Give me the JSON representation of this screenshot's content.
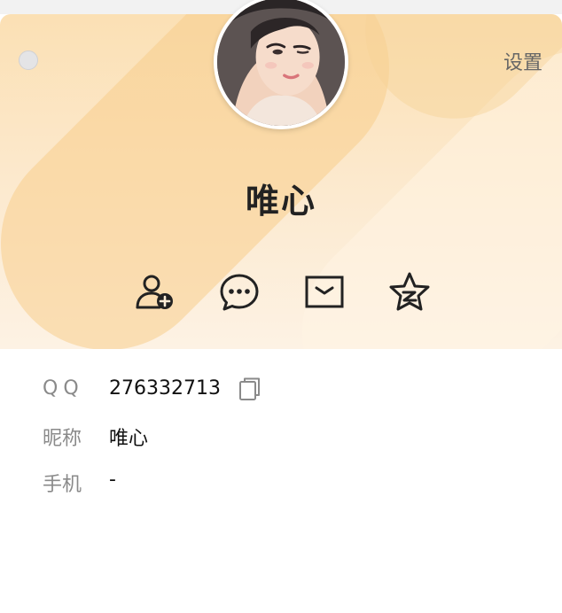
{
  "header": {
    "settings_label": "设置",
    "display_name": "唯心"
  },
  "actions": [
    {
      "name": "add-friend",
      "icon": "add-user-icon"
    },
    {
      "name": "message",
      "icon": "chat-bubble-icon"
    },
    {
      "name": "mail",
      "icon": "mail-icon"
    },
    {
      "name": "qzone",
      "icon": "star-z-icon"
    }
  ],
  "info": {
    "qq_label": "QQ",
    "qq_value": "276332713",
    "nickname_label": "昵称",
    "nickname_value": "唯心",
    "phone_label": "手机",
    "phone_value": "-"
  },
  "colors": {
    "header_top": "#fbe0b4",
    "header_bottom": "#fdf2e4",
    "label_gray": "#8a8a8a",
    "icon_dark": "#222222"
  }
}
